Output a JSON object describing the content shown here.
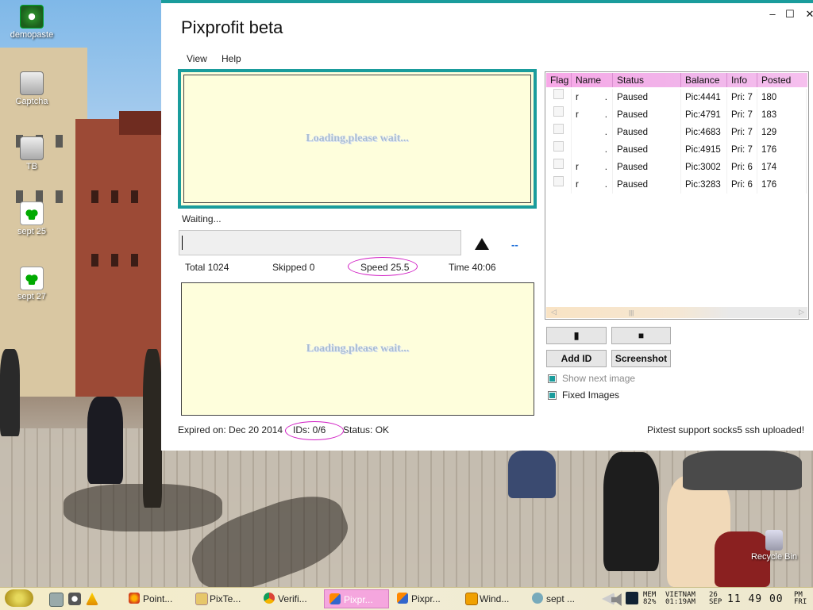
{
  "desktop": {
    "icons": [
      {
        "label": "demopaste",
        "icon": "avi-file-icon"
      },
      {
        "label": "Captcha",
        "icon": "keyboard-icon"
      },
      {
        "label": "TB",
        "icon": "keyboard-icon"
      },
      {
        "label": "sept 25",
        "icon": "jpg-file-icon"
      },
      {
        "label": "sept 27",
        "icon": "jpg-file-icon"
      }
    ],
    "recycle_bin": "Recycle Bin"
  },
  "window": {
    "title": "Pixprofit beta",
    "controls": {
      "minimize": "–",
      "maximize": "☐",
      "close": "✕"
    },
    "menu": [
      "View",
      "Help"
    ],
    "loading_top": "Loading,please wait...",
    "loading_bottom": "Loading,please wait...",
    "waiting": "Waiting...",
    "dash": "--",
    "stats": {
      "total": "Total 1024",
      "skipped": "Skipped 0",
      "speed": "Speed 25.5",
      "time": "Time 40:06"
    },
    "footer": {
      "expired": "Expired on: Dec 20 2014",
      "ids": "IDs: 0/6",
      "status": "Status: OK",
      "message": "Pixtest support socks5  ssh uploaded!"
    },
    "table": {
      "columns": [
        "Flag",
        "Name",
        "Status",
        "Balance",
        "Info",
        "Posted"
      ],
      "rows": [
        {
          "name": "r",
          "dot": ".",
          "status": "Paused",
          "balance": "Pic:4441",
          "info": "Pri: 7",
          "posted": "180"
        },
        {
          "name": "r",
          "dot": ".",
          "status": "Paused",
          "balance": "Pic:4791",
          "info": "Pri: 7",
          "posted": "183"
        },
        {
          "name": "",
          "dot": ".",
          "status": "Paused",
          "balance": "Pic:4683",
          "info": "Pri: 7",
          "posted": "129"
        },
        {
          "name": "",
          "dot": ".",
          "status": "Paused",
          "balance": "Pic:4915",
          "info": "Pri: 7",
          "posted": "176"
        },
        {
          "name": "r",
          "dot": ".",
          "status": "Paused",
          "balance": "Pic:3002",
          "info": "Pri: 6",
          "posted": "174"
        },
        {
          "name": "r",
          "dot": ".",
          "status": "Paused",
          "balance": "Pic:3283",
          "info": "Pri: 6",
          "posted": "176"
        }
      ]
    },
    "buttons": {
      "play_glyph": "▮",
      "stop_glyph": "■",
      "add_id": "Add ID",
      "screenshot": "Screenshot"
    },
    "checkboxes": [
      {
        "label": "Show next image",
        "checked": true,
        "enabled": false
      },
      {
        "label": "Fixed Images",
        "checked": true,
        "enabled": true
      }
    ],
    "accent_color": "#1a9c9c",
    "highlight_color": "#d11fc4"
  },
  "taskbar": {
    "tasks": [
      {
        "label": "Point...",
        "icon": "firefox-icon",
        "active": false
      },
      {
        "label": "PixTe...",
        "icon": "folder-icon",
        "active": false
      },
      {
        "label": "Verifi...",
        "icon": "chrome-icon",
        "active": false
      },
      {
        "label": "Pixpr...",
        "icon": "app-icon",
        "active": true
      },
      {
        "label": "Pixpr...",
        "icon": "app-icon",
        "active": false
      },
      {
        "label": "Wind...",
        "icon": "media-player-icon",
        "active": false
      },
      {
        "label": "sept ...",
        "icon": "image-viewer-icon",
        "active": false
      }
    ],
    "tray": {
      "mem_label": "MEM",
      "mem_value": "82%",
      "region": "VIETNAM",
      "region_time": "01:19AM",
      "date_day": "26",
      "date_month": "SEP",
      "clock": "11 49 00",
      "ampm": "PM",
      "weekday": "FRI"
    }
  }
}
